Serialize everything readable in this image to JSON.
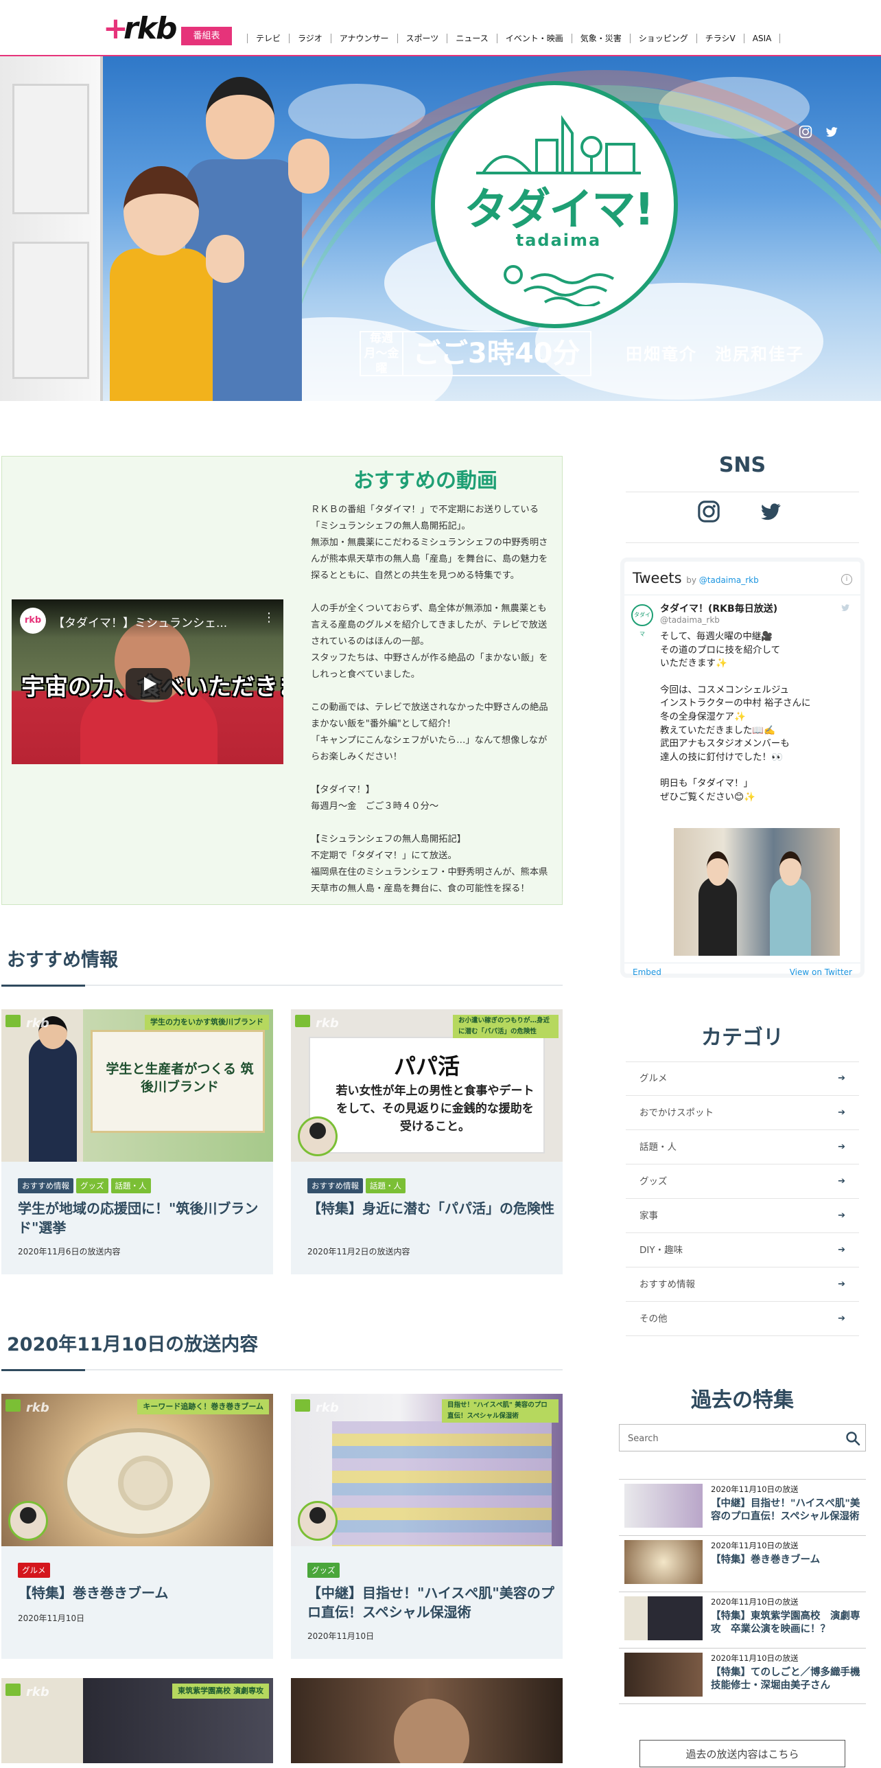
{
  "header": {
    "logo_text": "rkb",
    "program_button": "番組表",
    "nav": [
      "テレビ",
      "ラジオ",
      "アナウンサー",
      "スポーツ",
      "ニュース",
      "イベント・映画",
      "気象・災害",
      "ショッピング",
      "チラシV",
      "ASIA"
    ]
  },
  "hero": {
    "show_title": "タダイマ!",
    "show_subtitle": "tadaima",
    "days": "毎週月〜金曜",
    "time": "ごご3時40分",
    "hosts": "田畑竜介　池尻和佳子",
    "icons": [
      "instagram-icon",
      "twitter-icon"
    ]
  },
  "featured": {
    "title": "おすすめの動画",
    "video": {
      "channel": "rkb",
      "title": "【タダイマ！】ミシュランシェ...",
      "caption": "宇宙の力、食べいただきます"
    },
    "description": [
      "ＲＫＢの番組「タダイマ！」で不定期にお送りしている「ミシュランシェフの無人島開拓記」。",
      "無添加・無農薬にこだわるミシュランシェフの中野秀明さんが熊本県天草市の無人島「産島」を舞台に、島の魅力を探るとともに、自然との共生を見つめる特集です。",
      "",
      "人の手が全くついておらず、島全体が無添加・無農薬とも言える産島のグルメを紹介してきましたが、テレビで放送されているのはほんの一部。",
      "スタッフたちは、中野さんが作る絶品の「まかない飯」をしれっと食べていました。",
      "",
      "この動画では、テレビで放送されなかった中野さんの絶品まかない飯を\"番外編\"として紹介！",
      "「キャンプにこんなシェフがいたら…」なんて想像しながらお楽しみください！",
      "",
      "【タダイマ！】",
      "毎週月～金　ごご３時４０分～",
      "",
      "【ミシュランシェフの無人島開拓記】",
      "不定期で「タダイマ！」にて放送。",
      "福岡県在住のミシュランシェフ・中野秀明さんが、熊本県天草市の無人島・産島を舞台に、食の可能性を探る！"
    ]
  },
  "recommended": {
    "heading": "おすすめ情報",
    "cards": [
      {
        "tags": [
          "おすすめ情報",
          "グッズ",
          "話題・人"
        ],
        "title": "学生が地域の応援団に！\"筑後川ブランド\"選挙",
        "date": "2020年11月6日の放送内容",
        "thumb_text": "学生と生産者がつくる 筑後川ブランド",
        "ribbon": "学生の力をいかす筑後川ブランド"
      },
      {
        "tags": [
          "おすすめ情報",
          "話題・人"
        ],
        "title": "【特集】身近に潜む「パパ活」の危険性",
        "date": "2020年11月2日の放送内容",
        "thumb_title": "パパ活",
        "thumb_body": "若い女性が年上の男性と食事やデートをして、その見返りに金銭的な援助を受けること。",
        "ribbon": "お小遣い稼ぎのつもりが…身近に潜む「パパ活」の危険性"
      }
    ]
  },
  "broadcast": {
    "heading": "2020年11月10日の放送内容",
    "cards": [
      {
        "tags": [
          "グルメ"
        ],
        "title": "【特集】巻き巻きブーム",
        "date": "2020年11月10日",
        "ribbon": "キーワード追跡く！巻き巻きブーム"
      },
      {
        "tags": [
          "グッズ"
        ],
        "title": "【中継】目指せ！\"ハイスぺ肌\"美容のプロ直伝！スペシャル保湿術",
        "date": "2020年11月10日",
        "ribbon": "目指せ！\"ハイスぺ肌\" 美容のプロ直伝！スペシャル保湿術"
      }
    ],
    "more_cards": [
      {
        "ribbon": "東筑紫学園高校 演劇専攻"
      },
      {}
    ]
  },
  "sidebar": {
    "sns_title": "SNS",
    "sns_icons": [
      "instagram-icon",
      "twitter-icon"
    ],
    "tweets": {
      "header": "Tweets",
      "by": "by",
      "handle_link": "@tadaima_rkb",
      "account_name": "タダイマ！(RKB毎日放送)",
      "account_handle": "@tadaima_rkb",
      "avatar_text": "タダイマ",
      "body": [
        "そして、毎週火曜の中継🎥",
        "その道のプロに技を紹介して",
        "いただきます✨",
        "",
        "今回は、コスメコンシェルジュ",
        "インストラクターの中村 裕子さんに",
        "冬の全身保湿ケア✨",
        "教えていただきました📖✍️",
        "武田アナもスタジオメンバーも",
        "達人の技に釘付けでした！👀",
        "",
        "明日も「タダイマ！」",
        "ぜひご覧ください😊✨"
      ],
      "embed": "Embed",
      "view_on": "View on Twitter"
    },
    "category_title": "カテゴリ",
    "categories": [
      "グルメ",
      "おでかけスポット",
      "話題・人",
      "グッズ",
      "家事",
      "DIY・趣味",
      "おすすめ情報",
      "その他"
    ],
    "arrow_icon": "arrow-right-icon",
    "past_title": "過去の特集",
    "search_placeholder": "Search",
    "past_items": [
      {
        "date": "2020年11月10日の放送",
        "title": "【中継】目指せ！\"ハイスぺ肌\"美容のプロ直伝！スペシャル保湿術"
      },
      {
        "date": "2020年11月10日の放送",
        "title": "【特集】巻き巻きブーム"
      },
      {
        "date": "2020年11月10日の放送",
        "title": "【特集】東筑紫学園高校　演劇専攻　卒業公演を映画に！？"
      },
      {
        "date": "2020年11月10日の放送",
        "title": "【特集】てのしごと／博多織手機技能修士・深堀由美子さん"
      }
    ],
    "past_button": "過去の放送内容はこちら"
  },
  "colors": {
    "brand_pink": "#e6337a",
    "show_green": "#1e9f74",
    "navy": "#2f4a5e",
    "tag_green": "#7bbf35",
    "tag_red": "#d4161d"
  }
}
